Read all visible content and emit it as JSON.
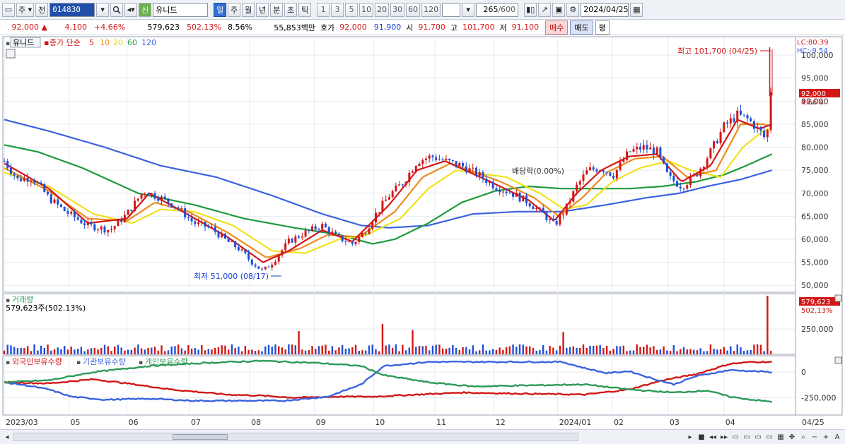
{
  "toolbar": {
    "market": "주",
    "prev_label": "전",
    "code": "014830",
    "new_badge": "신",
    "name": "유니드",
    "periods": [
      "일",
      "주",
      "월",
      "년",
      "분",
      "초",
      "틱"
    ],
    "active_period": "일",
    "intervals": [
      "1",
      "3",
      "5",
      "10",
      "20",
      "30",
      "60",
      "120"
    ],
    "count": "265",
    "count_max": "/600",
    "date": "2024/04/25"
  },
  "info": {
    "price": "92,000",
    "change": "4,100",
    "change_pct": "+4.66%",
    "volume": "579,623",
    "volume_ratio": "502.13%",
    "turnover": "8.56%",
    "amount": "55,853백만",
    "quote_label": "호가",
    "ask": "92,000",
    "bid": "91,900",
    "open_label": "시",
    "open": "91,700",
    "high_label": "고",
    "high": "101,700",
    "low_label": "저",
    "low": "91,100",
    "buy_label": "매수",
    "sell_label": "매도",
    "avg_label": "평"
  },
  "chart_data": {
    "type": "candlestick",
    "title": "유니드",
    "ma_label": "종가 단순",
    "ma_periods": [
      "5",
      "10",
      "20",
      "60",
      "120"
    ],
    "ma_colors": [
      "#d31717",
      "#ef8a1b",
      "#f0e21a",
      "#1f9a3c",
      "#3b63e0"
    ],
    "y_ticks": [
      "100,000",
      "95,000",
      "90,000",
      "85,000",
      "80,000",
      "75,000",
      "70,000",
      "65,000",
      "60,000",
      "55,000",
      "50,000"
    ],
    "ylim": [
      48500,
      104000
    ],
    "lc": "LC:80.39",
    "hc": "HC:-9.54",
    "last_price": "92,000",
    "last_pct": "4.66%",
    "annotation_high": "최고 101,700 (04/25)",
    "annotation_low": "최저 51,000 (08/17)",
    "annotation_div": "배당락(0.00%)",
    "x_labels": [
      "2023/03",
      "05",
      "06",
      "07",
      "08",
      "09",
      "10",
      "11",
      "12",
      "2024/01",
      "02",
      "03",
      "04",
      "04/25"
    ],
    "price_points": [
      [
        0,
        77000
      ],
      [
        12,
        73000
      ],
      [
        25,
        73500
      ],
      [
        40,
        69000
      ],
      [
        55,
        66000
      ],
      [
        75,
        63000
      ],
      [
        95,
        62000
      ],
      [
        110,
        65500
      ],
      [
        125,
        70500
      ],
      [
        140,
        69000
      ],
      [
        155,
        67000
      ],
      [
        170,
        63500
      ],
      [
        185,
        62500
      ],
      [
        200,
        59500
      ],
      [
        210,
        58000
      ],
      [
        220,
        55500
      ],
      [
        232,
        53000
      ],
      [
        242,
        55500
      ],
      [
        255,
        59500
      ],
      [
        270,
        61500
      ],
      [
        285,
        63000
      ],
      [
        298,
        60500
      ],
      [
        312,
        59000
      ],
      [
        323,
        61500
      ],
      [
        333,
        65500
      ],
      [
        345,
        69500
      ],
      [
        358,
        72500
      ],
      [
        370,
        77000
      ],
      [
        383,
        78000
      ],
      [
        395,
        77000
      ],
      [
        410,
        76000
      ],
      [
        425,
        74000
      ],
      [
        440,
        71500
      ],
      [
        455,
        70000
      ],
      [
        470,
        68000
      ],
      [
        483,
        65500
      ],
      [
        493,
        63000
      ],
      [
        503,
        66500
      ],
      [
        513,
        71500
      ],
      [
        523,
        75000
      ],
      [
        535,
        75500
      ],
      [
        546,
        74000
      ],
      [
        560,
        79000
      ],
      [
        573,
        80000
      ],
      [
        585,
        79000
      ],
      [
        595,
        73500
      ],
      [
        607,
        71500
      ],
      [
        620,
        74000
      ],
      [
        633,
        79000
      ],
      [
        645,
        84500
      ],
      [
        657,
        87000
      ],
      [
        667,
        86000
      ],
      [
        677,
        83500
      ],
      [
        683,
        81500
      ],
      [
        688,
        92000
      ]
    ],
    "ma_lines": {
      "ma5": [
        [
          0,
          76500
        ],
        [
          40,
          71000
        ],
        [
          75,
          63500
        ],
        [
          110,
          64500
        ],
        [
          130,
          70000
        ],
        [
          160,
          66000
        ],
        [
          200,
          60500
        ],
        [
          232,
          55000
        ],
        [
          255,
          57500
        ],
        [
          285,
          62000
        ],
        [
          312,
          59500
        ],
        [
          345,
          67500
        ],
        [
          370,
          75000
        ],
        [
          395,
          77000
        ],
        [
          440,
          72000
        ],
        [
          470,
          68500
        ],
        [
          493,
          64000
        ],
        [
          513,
          70000
        ],
        [
          535,
          75000
        ],
        [
          560,
          78000
        ],
        [
          585,
          78500
        ],
        [
          607,
          72500
        ],
        [
          633,
          76000
        ],
        [
          657,
          86000
        ],
        [
          677,
          84000
        ],
        [
          688,
          85000
        ]
      ],
      "ma10": [
        [
          0,
          75500
        ],
        [
          40,
          70500
        ],
        [
          75,
          64500
        ],
        [
          110,
          64000
        ],
        [
          135,
          68000
        ],
        [
          165,
          66000
        ],
        [
          200,
          61500
        ],
        [
          235,
          56000
        ],
        [
          265,
          58000
        ],
        [
          290,
          61000
        ],
        [
          318,
          60500
        ],
        [
          350,
          66000
        ],
        [
          375,
          73500
        ],
        [
          400,
          76500
        ],
        [
          445,
          72500
        ],
        [
          475,
          69000
        ],
        [
          497,
          65000
        ],
        [
          518,
          69000
        ],
        [
          540,
          74500
        ],
        [
          565,
          77500
        ],
        [
          590,
          78000
        ],
        [
          612,
          73500
        ],
        [
          638,
          75000
        ],
        [
          660,
          85000
        ],
        [
          680,
          85000
        ],
        [
          688,
          84500
        ]
      ],
      "ma20": [
        [
          0,
          74500
        ],
        [
          40,
          71500
        ],
        [
          80,
          65500
        ],
        [
          115,
          63500
        ],
        [
          140,
          66500
        ],
        [
          170,
          66000
        ],
        [
          205,
          63000
        ],
        [
          240,
          57500
        ],
        [
          270,
          57000
        ],
        [
          300,
          60000
        ],
        [
          325,
          61000
        ],
        [
          355,
          64500
        ],
        [
          380,
          71000
        ],
        [
          405,
          75000
        ],
        [
          450,
          73500
        ],
        [
          480,
          70000
        ],
        [
          502,
          66500
        ],
        [
          522,
          67500
        ],
        [
          545,
          72500
        ],
        [
          570,
          75500
        ],
        [
          595,
          77000
        ],
        [
          615,
          75000
        ],
        [
          642,
          73500
        ],
        [
          662,
          80000
        ],
        [
          680,
          83500
        ],
        [
          688,
          84000
        ]
      ],
      "ma60": [
        [
          0,
          80500
        ],
        [
          30,
          79000
        ],
        [
          70,
          75500
        ],
        [
          120,
          70000
        ],
        [
          170,
          67500
        ],
        [
          215,
          64500
        ],
        [
          260,
          62500
        ],
        [
          300,
          61000
        ],
        [
          330,
          59000
        ],
        [
          350,
          60000
        ],
        [
          380,
          63500
        ],
        [
          410,
          68000
        ],
        [
          440,
          70500
        ],
        [
          470,
          71500
        ],
        [
          500,
          71000
        ],
        [
          530,
          71000
        ],
        [
          560,
          71000
        ],
        [
          590,
          71500
        ],
        [
          620,
          72500
        ],
        [
          645,
          74000
        ],
        [
          665,
          76000
        ],
        [
          688,
          78500
        ]
      ],
      "ma120": [
        [
          0,
          86000
        ],
        [
          40,
          83500
        ],
        [
          90,
          80000
        ],
        [
          140,
          76000
        ],
        [
          190,
          73500
        ],
        [
          240,
          69500
        ],
        [
          285,
          65500
        ],
        [
          320,
          63000
        ],
        [
          345,
          62500
        ],
        [
          380,
          63000
        ],
        [
          420,
          65500
        ],
        [
          460,
          66000
        ],
        [
          500,
          66000
        ],
        [
          540,
          67500
        ],
        [
          575,
          69000
        ],
        [
          605,
          70000
        ],
        [
          630,
          71500
        ],
        [
          660,
          73000
        ],
        [
          688,
          75000
        ]
      ]
    },
    "volume": {
      "label": "거래량",
      "value_text": "579,623주(502.13%)",
      "tick": "250,000",
      "last_value": "579,623",
      "last_pct": "502,13%",
      "ylim": [
        0,
        600000
      ],
      "spikes": [
        [
          263,
          230000
        ],
        [
          339,
          300000
        ],
        [
          367,
          240000
        ],
        [
          501,
          220000
        ],
        [
          684,
          579623
        ]
      ]
    },
    "investor": {
      "labels": [
        "외국인보유수량",
        "기관보유수량",
        "개인보유수량"
      ],
      "colors": [
        "#d31717",
        "#3b63e0",
        "#2d9a58"
      ],
      "ticks": [
        "0",
        "-250,000"
      ],
      "ylim": [
        -420000,
        160000
      ],
      "foreign": [
        [
          0,
          -100000
        ],
        [
          40,
          -110000
        ],
        [
          80,
          -70000
        ],
        [
          110,
          -110000
        ],
        [
          150,
          -170000
        ],
        [
          200,
          -220000
        ],
        [
          230,
          -230000
        ],
        [
          260,
          -250000
        ],
        [
          300,
          -240000
        ],
        [
          330,
          -240000
        ],
        [
          370,
          -220000
        ],
        [
          410,
          -200000
        ],
        [
          460,
          -210000
        ],
        [
          520,
          -220000
        ],
        [
          560,
          -170000
        ],
        [
          590,
          -80000
        ],
        [
          620,
          -20000
        ],
        [
          650,
          80000
        ],
        [
          670,
          100000
        ],
        [
          688,
          100000
        ]
      ],
      "institution": [
        [
          0,
          -100000
        ],
        [
          20,
          -130000
        ],
        [
          40,
          -170000
        ],
        [
          60,
          -240000
        ],
        [
          90,
          -270000
        ],
        [
          130,
          -260000
        ],
        [
          170,
          -280000
        ],
        [
          210,
          -280000
        ],
        [
          250,
          -280000
        ],
        [
          290,
          -240000
        ],
        [
          320,
          -120000
        ],
        [
          340,
          60000
        ],
        [
          380,
          100000
        ],
        [
          420,
          100000
        ],
        [
          470,
          100000
        ],
        [
          500,
          100000
        ],
        [
          520,
          40000
        ],
        [
          540,
          -10000
        ],
        [
          560,
          10000
        ],
        [
          580,
          -60000
        ],
        [
          600,
          -120000
        ],
        [
          620,
          -40000
        ],
        [
          650,
          20000
        ],
        [
          670,
          10000
        ],
        [
          688,
          0
        ]
      ],
      "individual": [
        [
          0,
          -100000
        ],
        [
          40,
          -80000
        ],
        [
          60,
          -40000
        ],
        [
          80,
          0
        ],
        [
          130,
          60000
        ],
        [
          180,
          90000
        ],
        [
          230,
          110000
        ],
        [
          280,
          90000
        ],
        [
          320,
          60000
        ],
        [
          340,
          -30000
        ],
        [
          380,
          -100000
        ],
        [
          420,
          -140000
        ],
        [
          470,
          -130000
        ],
        [
          520,
          -120000
        ],
        [
          560,
          -170000
        ],
        [
          600,
          -200000
        ],
        [
          630,
          -180000
        ],
        [
          650,
          -240000
        ],
        [
          670,
          -270000
        ],
        [
          688,
          -290000
        ]
      ]
    }
  }
}
